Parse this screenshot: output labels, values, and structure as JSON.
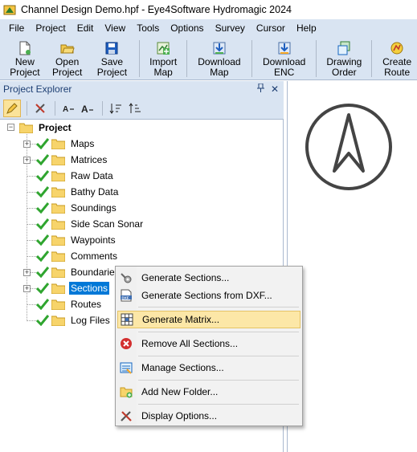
{
  "window": {
    "title": "Channel Design Demo.hpf - Eye4Software Hydromagic 2024"
  },
  "menu": [
    "File",
    "Project",
    "Edit",
    "View",
    "Tools",
    "Options",
    "Survey",
    "Cursor",
    "Help"
  ],
  "toolbar": [
    {
      "line1": "New",
      "line2": "Project",
      "icon": "new-project-icon"
    },
    {
      "line1": "Open",
      "line2": "Project",
      "icon": "open-project-icon"
    },
    {
      "line1": "Save",
      "line2": "Project",
      "icon": "save-project-icon"
    },
    {
      "line1": "Import",
      "line2": "Map",
      "icon": "import-map-icon"
    },
    {
      "line1": "Download",
      "line2": "Map",
      "icon": "download-map-icon"
    },
    {
      "line1": "Download",
      "line2": "ENC",
      "icon": "download-enc-icon"
    },
    {
      "line1": "Drawing",
      "line2": "Order",
      "icon": "drawing-order-icon"
    },
    {
      "line1": "Create",
      "line2": "Route",
      "icon": "create-route-icon"
    }
  ],
  "explorer": {
    "title": "Project Explorer",
    "pin": "ᵖ",
    "close": "✕",
    "root": "Project",
    "nodes": [
      "Maps",
      "Matrices",
      "Raw Data",
      "Bathy Data",
      "Soundings",
      "Side Scan Sonar",
      "Waypoints",
      "Comments",
      "Boundaries",
      "Sections",
      "Routes",
      "Log Files"
    ],
    "selected": "Sections"
  },
  "context_menu": [
    "Generate Sections...",
    "Generate Sections from DXF...",
    "Generate Matrix...",
    "Remove All Sections...",
    "Manage Sections...",
    "Add New Folder...",
    "Display Options..."
  ],
  "colors": {
    "accent": "#0078d7",
    "menubar": "#d9e4f2",
    "highlight": "#fce7a7"
  }
}
